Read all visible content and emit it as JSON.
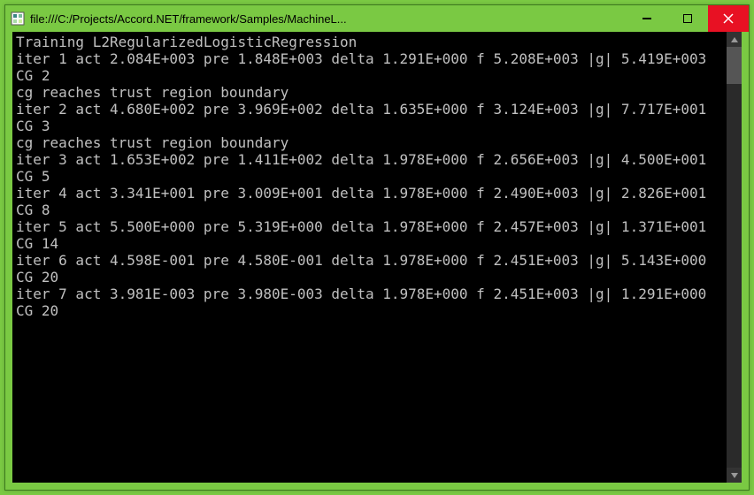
{
  "window": {
    "title": "file:///C:/Projects/Accord.NET/framework/Samples/MachineL..."
  },
  "console": {
    "lines": [
      "Training L2RegularizedLogisticRegression",
      "iter 1 act 2.084E+003 pre 1.848E+003 delta 1.291E+000 f 5.208E+003 |g| 5.419E+003 CG 2",
      "cg reaches trust region boundary",
      "iter 2 act 4.680E+002 pre 3.969E+002 delta 1.635E+000 f 3.124E+003 |g| 7.717E+001 CG 3",
      "cg reaches trust region boundary",
      "iter 3 act 1.653E+002 pre 1.411E+002 delta 1.978E+000 f 2.656E+003 |g| 4.500E+001 CG 5",
      "iter 4 act 3.341E+001 pre 3.009E+001 delta 1.978E+000 f 2.490E+003 |g| 2.826E+001 CG 8",
      "iter 5 act 5.500E+000 pre 5.319E+000 delta 1.978E+000 f 2.457E+003 |g| 1.371E+001 CG 14",
      "iter 6 act 4.598E-001 pre 4.580E-001 delta 1.978E+000 f 2.451E+003 |g| 5.143E+000 CG 20",
      "iter 7 act 3.981E-003 pre 3.980E-003 delta 1.978E+000 f 2.451E+003 |g| 1.291E+000 CG 20"
    ]
  }
}
